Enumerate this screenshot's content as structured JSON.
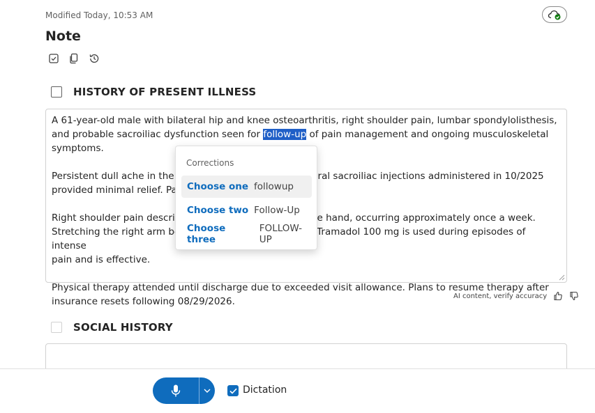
{
  "header": {
    "modified": "Modified Today, 10:53 AM",
    "title": "Note"
  },
  "sections": {
    "hpi": {
      "heading": "HISTORY OF PRESENT ILLNESS",
      "p1_before": "A 61-year-old male with bilateral hip and knee osteoarthritis, right shoulder pain, lumbar spondylolisthesis, and probable sacroiliac dysfunction seen for ",
      "p1_selected": "follow-up",
      "p1_after": " of pain management and ongoing musculoskeletal symptoms.",
      "p2_line1_left": "Persistent dull ache in the lo",
      "p2_line1_right": "Bilateral sacroiliac injections administered in 10/2025",
      "p2_line2": "provided minimal relief. Pain",
      "p3_line1_left": "Right shoulder pain describe",
      "p3_line1_right": "the hand, occurring approximately once a week.",
      "p3_line2_left": "Stretching the right arm beh",
      "p3_line2_right": "f. Tramadol 100 mg is used during episodes of intense",
      "p3_line3": "pain and is effective.",
      "p4": "Physical therapy attended until discharge due to exceeded visit allowance. Plans to resume therapy after insurance resets following 08/29/2026."
    },
    "social": {
      "heading": "SOCIAL HISTORY"
    }
  },
  "ai_note": "AI content, verify accuracy",
  "corrections": {
    "heading": "Corrections",
    "options": [
      {
        "key": "Choose one",
        "value": "followup"
      },
      {
        "key": "Choose two",
        "value": "Follow-Up"
      },
      {
        "key": "Choose three",
        "value": "FOLLOW-UP"
      }
    ]
  },
  "footer": {
    "dictation_label": "Dictation"
  },
  "colors": {
    "accent": "#0f6cbd",
    "selection": "#1f5fc7",
    "sync_ok": "#107c10"
  }
}
